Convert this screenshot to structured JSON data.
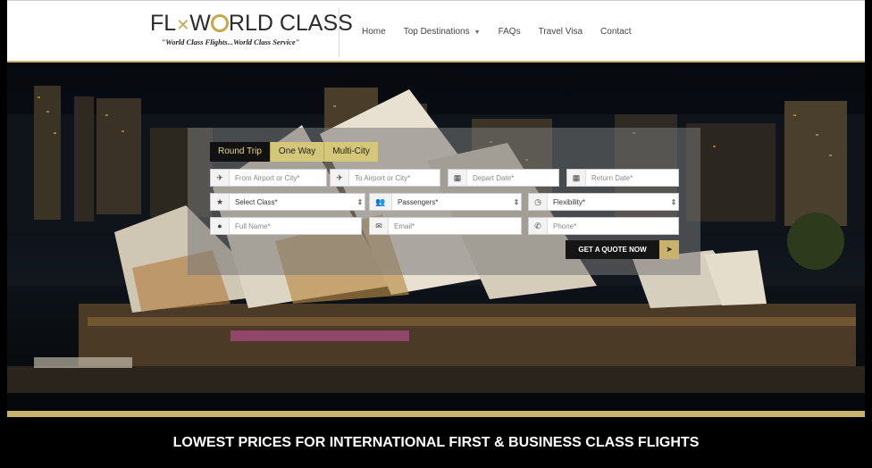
{
  "logo": {
    "name_prefix": "FL",
    "name_suffix": "RLD CLASS",
    "tagline": "\"World Class Flights...World Class Service\""
  },
  "nav": {
    "items": [
      {
        "label": "Home"
      },
      {
        "label": "Top Destinations"
      },
      {
        "label": "FAQs"
      },
      {
        "label": "Travel Visa"
      },
      {
        "label": "Contact"
      }
    ]
  },
  "form": {
    "tabs": [
      {
        "label": "Round Trip",
        "active": true
      },
      {
        "label": "One Way",
        "active": false
      },
      {
        "label": "Multi-City",
        "active": false
      }
    ],
    "from": {
      "placeholder": "From Airport or City*",
      "icon": "plane-icon"
    },
    "to": {
      "placeholder": "To Airport or City*",
      "icon": "plane-icon"
    },
    "depart": {
      "placeholder": "Depart Date*",
      "icon": "calendar-icon"
    },
    "return": {
      "placeholder": "Return Date*",
      "icon": "calendar-icon"
    },
    "class": {
      "value": "Select Class*",
      "icon": "star-icon"
    },
    "passengers": {
      "value": "Passengers*",
      "icon": "users-icon"
    },
    "flexibility": {
      "value": "Flexibility*",
      "icon": "clock-icon"
    },
    "name": {
      "placeholder": "Full Name*",
      "icon": "user-icon"
    },
    "email": {
      "placeholder": "Email*",
      "icon": "envelope-icon"
    },
    "phone": {
      "placeholder": "Phone*",
      "icon": "phone-icon"
    },
    "submit_label": "GET A QUOTE NOW"
  },
  "banner": {
    "headline": "LOWEST PRICES FOR INTERNATIONAL FIRST & BUSINESS CLASS FLIGHTS"
  },
  "colors": {
    "gold": "#c9b26b",
    "tab_gold": "#d4c77a",
    "dark": "#111111"
  }
}
